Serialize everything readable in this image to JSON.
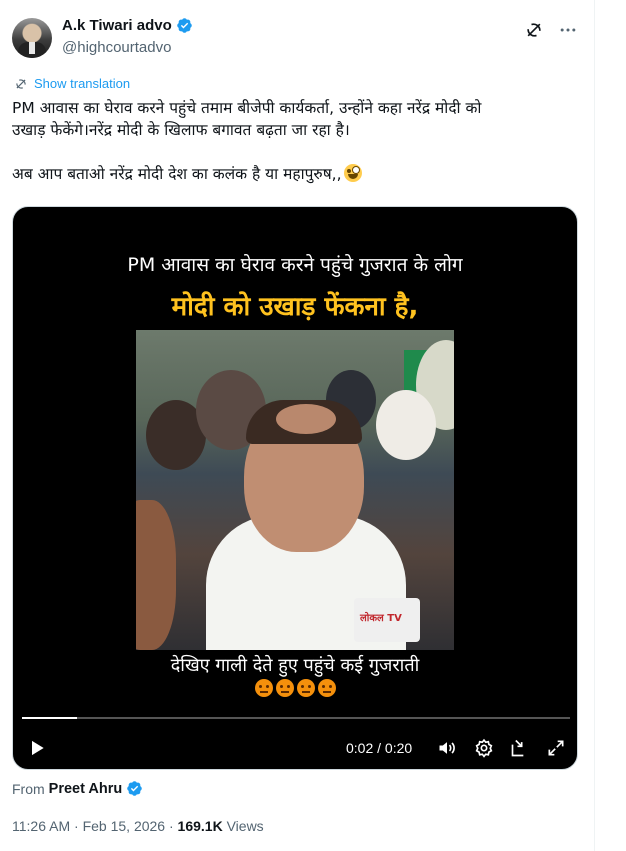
{
  "author": {
    "display_name": "A.k Tiwari advo",
    "handle": "@highcourtadvo",
    "verified": true
  },
  "translation": {
    "label": "Show translation"
  },
  "tweet": {
    "line1": "PM आवास का घेराव करने पहुंचे तमाम बीजेपी कार्यकर्ता, उन्होंने कहा नरेंद्र मोदी को",
    "line2": "उखाड़ फेकेंगे।नरेंद्र मोदी के खिलाफ बगावत बढ़ता जा रहा है।",
    "line3": "अब आप बताओ नरेंद्र मोदी देश का कलंक है या महापुरुष,,"
  },
  "video": {
    "caption_top": "PM आवास का घेराव करने पहुंचे गुजरात के लोग",
    "caption_highlight": "मोदी को उखाड़ फेंकना है,",
    "caption_bottom": "देखिए गाली देते हुए पहुंचे कई गुजराती",
    "mic_label": "लोकल TV",
    "current_time": "0:02",
    "duration": "0:20",
    "time_display": "0:02 / 0:20",
    "progress_fraction": 0.1
  },
  "attribution": {
    "from_label": "From",
    "from_name": "Preet Ahru",
    "verified": true
  },
  "meta": {
    "time": "11:26 AM",
    "date": "Feb 15, 2026",
    "separator": "·",
    "views_count": "169.1K",
    "views_label": "Views"
  },
  "colors": {
    "accent": "#1d9bf0",
    "text": "#0f1419",
    "muted": "#536471",
    "caption_highlight": "#ffc21f"
  },
  "icons": {
    "verified": "verified-badge-icon",
    "grok": "grok-icon",
    "more": "more-icon",
    "translate": "translate-icon",
    "play": "play-icon",
    "volume": "volume-icon",
    "settings": "settings-icon",
    "pip": "picture-in-picture-icon",
    "fullscreen": "fullscreen-icon"
  }
}
